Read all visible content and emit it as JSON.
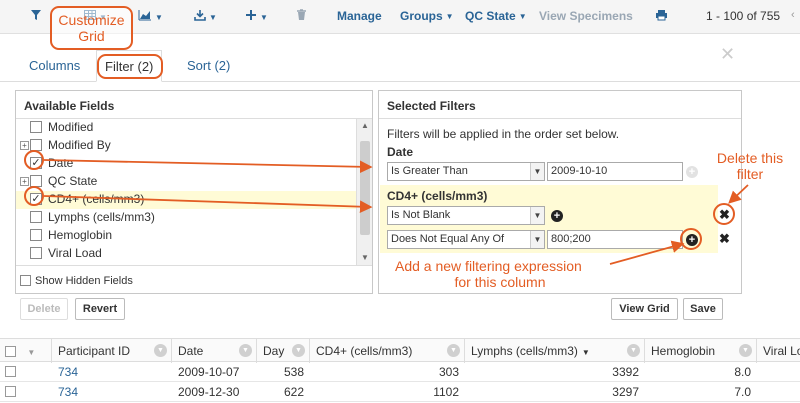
{
  "toolbar": {
    "manage": "Manage",
    "groups": "Groups",
    "qc_state": "QC State",
    "view_specimens": "View Specimens",
    "page_range": "1 - 100 of 755",
    "icons": [
      "filter-icon",
      "grid-icon",
      "chart-icon",
      "export-icon",
      "insert-icon",
      "delete-icon",
      "print-icon"
    ]
  },
  "tabs": [
    {
      "label": "Columns"
    },
    {
      "label": "Filter (2)"
    },
    {
      "label": "Sort (2)"
    }
  ],
  "available_fields": {
    "title": "Available Fields",
    "items": [
      {
        "label": "Modified",
        "checked": false,
        "expandable": false
      },
      {
        "label": "Modified By",
        "checked": false,
        "expandable": true
      },
      {
        "label": "Date",
        "checked": true,
        "expandable": false
      },
      {
        "label": "QC State",
        "checked": false,
        "expandable": true
      },
      {
        "label": "CD4+ (cells/mm3)",
        "checked": true,
        "expandable": false
      },
      {
        "label": "Lymphs (cells/mm3)",
        "checked": false,
        "expandable": false
      },
      {
        "label": "Hemoglobin",
        "checked": false,
        "expandable": false
      },
      {
        "label": "Viral Load",
        "checked": false,
        "expandable": false
      }
    ],
    "show_hidden": "Show Hidden Fields"
  },
  "selected_filters": {
    "title": "Selected Filters",
    "note": "Filters will be applied in the order set below.",
    "groups": [
      {
        "field": "Date",
        "operator": "Is Greater Than",
        "value": "2009-10-10"
      },
      {
        "field": "CD4+ (cells/mm3)",
        "operator": "Is Not Blank",
        "operator2": "Does Not Equal Any Of",
        "value2": "800;200"
      }
    ]
  },
  "buttons": {
    "delete": "Delete",
    "revert": "Revert",
    "view_grid": "View Grid",
    "save": "Save"
  },
  "grid": {
    "columns": [
      "Participant ID",
      "Date",
      "Day",
      "CD4+ (cells/mm3)",
      "Lymphs (cells/mm3)",
      "Hemoglobin",
      "Viral Lo"
    ],
    "rows": [
      {
        "participant": "734",
        "date": "2009-10-07",
        "day": "538",
        "cd4": "303",
        "lymphs": "3392",
        "hemoglobin": "8.0"
      },
      {
        "participant": "734",
        "date": "2009-12-30",
        "day": "622",
        "cd4": "1102",
        "lymphs": "3297",
        "hemoglobin": "7.0"
      }
    ]
  },
  "annotations": {
    "customize_grid": "Customize Grid",
    "delete_filter": "Delete this filter",
    "add_expression_line1": "Add a new filtering expression",
    "add_expression_line2": "for this column",
    "color": "#e35d24"
  }
}
